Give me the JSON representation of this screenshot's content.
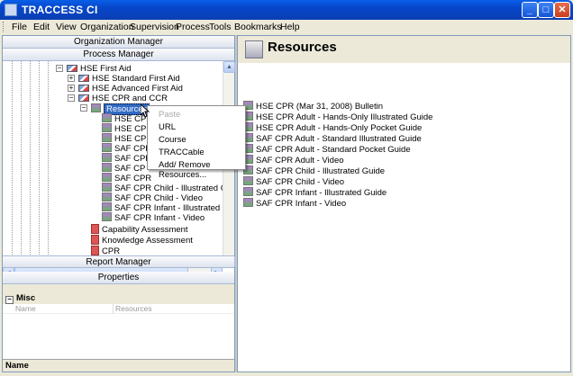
{
  "window": {
    "title": "TRACCESS CI",
    "minimize": "_",
    "maximize": "□",
    "close": "✕"
  },
  "menu": [
    "File",
    "Edit",
    "View",
    "Organization",
    "Supervision",
    "Process",
    "Tools",
    "Bookmarks",
    "Help"
  ],
  "left": {
    "org_manager": "Organization Manager",
    "process_manager": "Process Manager",
    "report_manager": "Report Manager",
    "properties": "Properties"
  },
  "tree": {
    "hse_first_aid": "HSE  First Aid",
    "hse_standard_first_aid": "HSE  Standard First Aid",
    "hse_advanced_first_aid": "HSE  Advanced First Aid",
    "hse_cpr_ccr": "HSE  CPR and CCR",
    "resources": "Resources",
    "children": [
      "HSE  CPR",
      "HSE  CPR",
      "HSE  CP",
      "SAF  CPR",
      "SAF  CPR",
      "SAF  CP",
      "SAF  CPR",
      "SAF  CPR Child - Illustrated Guide",
      "SAF  CPR Child - Video",
      "SAF  CPR Infant - Illustrated Guide",
      "SAF  CPR Infant - Video"
    ],
    "capability_assessment": "Capability Assessment",
    "knowledge_assessment": "Knowledge Assessment",
    "cpr": "CPR",
    "expand_plus": "+",
    "expand_minus": "−"
  },
  "context_menu": {
    "paste": "Paste",
    "url": "URL",
    "course": "Course",
    "traccable": "TRACCable",
    "add_remove": "Add/ Remove Resources..."
  },
  "properties": {
    "category": "Misc",
    "category_toggle": "−",
    "row_key": "Name",
    "row_value": "Resources",
    "footer": "Name"
  },
  "right": {
    "title": "Resources",
    "items": [
      "HSE  CPR (Mar 31, 2008) Bulletin",
      "HSE  CPR Adult - Hands-Only Illustrated Guide",
      "HSE  CPR Adult - Hands-Only Pocket Guide",
      "SAF  CPR Adult - Standard Illustrated Guide",
      "SAF  CPR Adult - Standard Pocket Guide",
      "SAF  CPR Adult - Video",
      "SAF  CPR Child - Illustrated Guide",
      "SAF  CPR Child - Video",
      "SAF  CPR Infant - Illustrated Guide",
      "SAF  CPR Infant - Video"
    ]
  },
  "scroll": {
    "up": "▲",
    "down": "▼",
    "left": "◄",
    "right": "►"
  }
}
